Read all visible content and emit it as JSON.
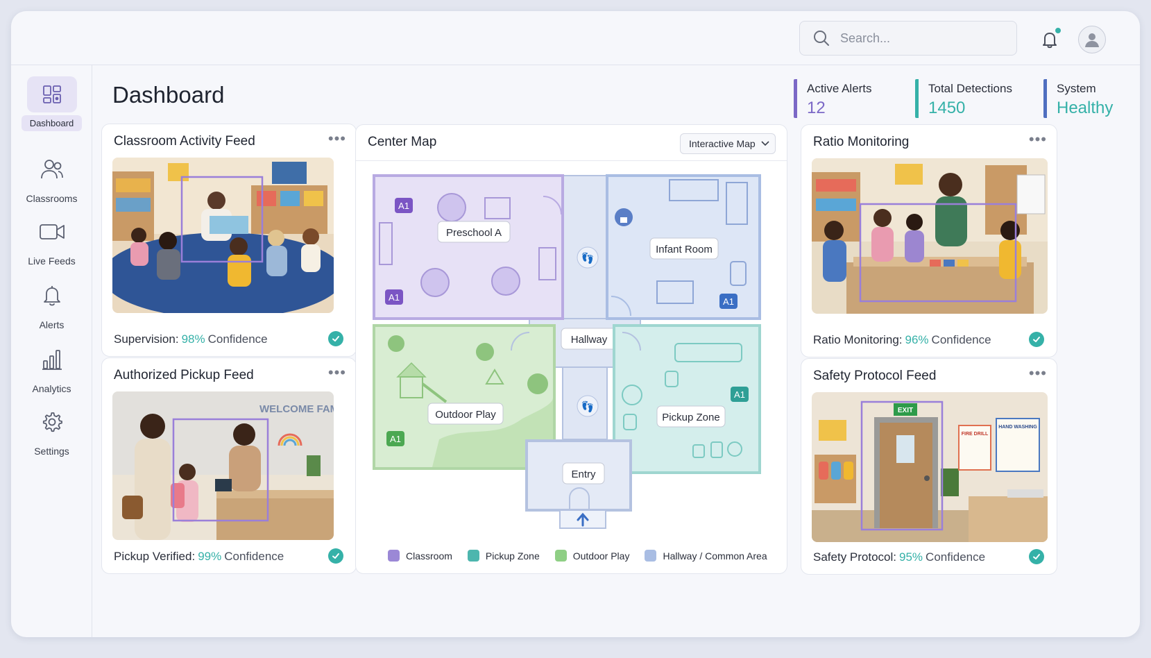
{
  "search": {
    "placeholder": "Search..."
  },
  "sidebar": {
    "items": [
      {
        "label": "Dashboard",
        "icon": "dashboard-icon"
      },
      {
        "label": "Classrooms",
        "icon": "users-icon"
      },
      {
        "label": "Live Feeds",
        "icon": "video-icon"
      },
      {
        "label": "Alerts",
        "icon": "bell-icon"
      },
      {
        "label": "Analytics",
        "icon": "bar-chart-icon"
      },
      {
        "label": "Settings",
        "icon": "gear-icon"
      }
    ]
  },
  "page": {
    "title": "Dashboard"
  },
  "stats": [
    {
      "label": "Active Alerts",
      "value": "12",
      "color": "#7b68c6"
    },
    {
      "label": "Total Detections",
      "value": "1450",
      "color": "#35b1a8"
    },
    {
      "label": "System",
      "value": "Healthy",
      "color": "#4f6fc0"
    }
  ],
  "feeds": {
    "classroom": {
      "title": "Classroom Activity Feed",
      "metric": "Supervision:",
      "pct": "98%",
      "word": "Confidence"
    },
    "pickup": {
      "title": "Authorized Pickup Feed",
      "metric": "Pickup Verified:",
      "pct": "99%",
      "word": "Confidence",
      "sign": "WELCOME FAMILIES"
    },
    "ratio": {
      "title": "Ratio Monitoring",
      "metric": "Ratio Monitoring:",
      "pct": "96%",
      "word": "Confidence"
    },
    "safety": {
      "title": "Safety Protocol Feed",
      "metric": "Safety Protocol:",
      "pct": "95%",
      "word": "Confidence",
      "exit": "EXIT",
      "poster1": "FIRE DRILL",
      "poster2": "HAND WASHING"
    }
  },
  "map": {
    "title": "Center Map",
    "view_select": "Interactive Map",
    "rooms": {
      "preschool": "Preschool A",
      "infant": "Infant Room",
      "hallway": "Hallway",
      "outdoor": "Outdoor Play",
      "pickup": "Pickup Zone",
      "entry": "Entry"
    },
    "badge": "A1",
    "legend": [
      {
        "label": "Classroom",
        "color": "#9b88d6"
      },
      {
        "label": "Pickup Zone",
        "color": "#4db6ae"
      },
      {
        "label": "Outdoor Play",
        "color": "#8fcf85"
      },
      {
        "label": "Hallway / Common Area",
        "color": "#a9bde3"
      }
    ]
  },
  "colors": {
    "accent_purple": "#7b68c6",
    "accent_teal": "#35b1a8",
    "detection_box": "#9a7fd9"
  }
}
